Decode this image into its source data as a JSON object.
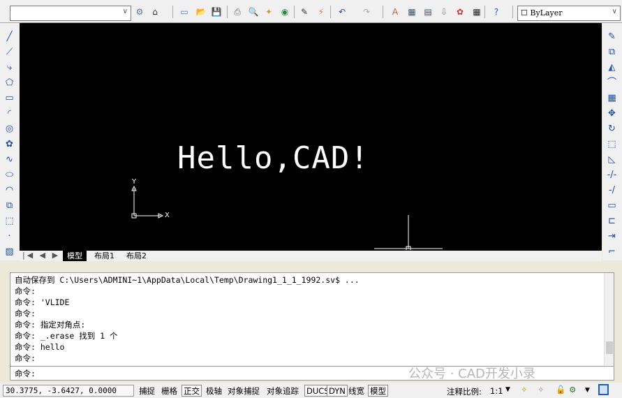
{
  "toolbar": {
    "workspace_value": "",
    "layer_value": "ByLayer",
    "icons": [
      "workspace-settings-icon",
      "home-icon",
      "new-icon",
      "open-icon",
      "save-icon",
      "print-icon",
      "print-preview-icon",
      "publish-icon",
      "3d-dwf-icon",
      "cut-icon",
      "match-properties-icon",
      "undo-icon",
      "redo-icon",
      "properties-icon",
      "design-center-icon",
      "tool-palettes-icon",
      "sheet-set-icon",
      "markup-icon",
      "calculator-icon",
      "help-icon"
    ]
  },
  "canvas": {
    "text": "Hello,CAD!",
    "ucs_x": "X",
    "ucs_y": "Y"
  },
  "tabs": [
    "模型",
    "布局1",
    "布局2"
  ],
  "command": {
    "lines": [
      "自动保存到 C:\\Users\\ADMINI~1\\AppData\\Local\\Temp\\Drawing1_1_1_1992.sv$ ...",
      "命令:",
      "命令: 'VLIDE",
      "命令:",
      "命令: 指定对角点:",
      "命令: _.erase 找到 1 个",
      "命令: hello",
      "命令:"
    ],
    "prompt": "命令:"
  },
  "status": {
    "coords": "30.3775, -3.6427, 0.0000",
    "buttons": [
      "捕捉",
      "栅格",
      "正交",
      "极轴",
      "对象捕捉",
      "对象追踪",
      "DUCS",
      "DYN",
      "线宽",
      "模型"
    ],
    "annotation_scale_label": "注释比例:",
    "annotation_scale": "1:1"
  },
  "watermark": "公众号 · CAD开发小录"
}
